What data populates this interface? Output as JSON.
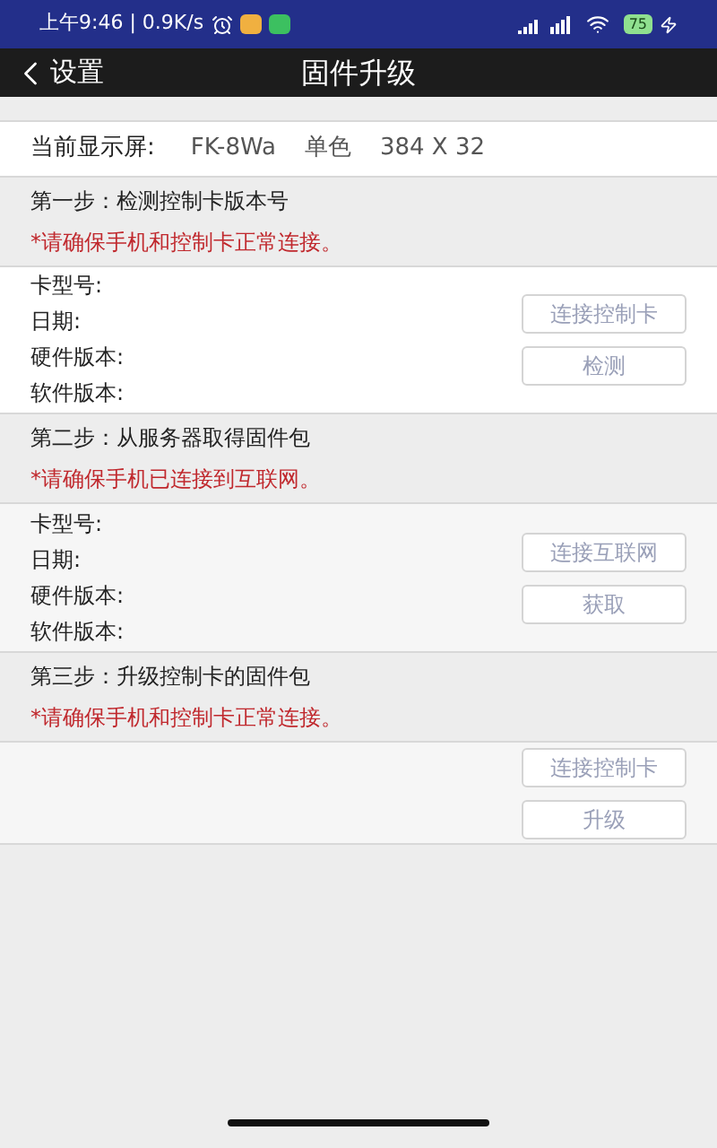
{
  "status_bar": {
    "time": "上午9:46 | 0.9K/s",
    "battery": "75"
  },
  "nav": {
    "back": "设置",
    "title": "固件升级"
  },
  "display": {
    "label": "当前显示屏:",
    "model": "FK-8Wa",
    "color_mode": "单色",
    "resolution": "384 X 32"
  },
  "steps": [
    {
      "title": "第一步：检测控制卡版本号",
      "warning": "*请确保手机和控制卡正常连接。",
      "fields": [
        "卡型号:",
        "日期:",
        "硬件版本:",
        "软件版本:"
      ],
      "buttons": [
        {
          "label": "连接控制卡",
          "disabled": true
        },
        {
          "label": "检测",
          "disabled": true
        }
      ]
    },
    {
      "title": "第二步：从服务器取得固件包",
      "warning": "*请确保手机已连接到互联网。",
      "fields": [
        "卡型号:",
        "日期:",
        "硬件版本:",
        "软件版本:"
      ],
      "buttons": [
        {
          "label": "连接互联网",
          "disabled": true
        },
        {
          "label": "获取",
          "disabled": true
        }
      ]
    },
    {
      "title": "第三步：升级控制卡的固件包",
      "warning": "*请确保手机和控制卡正常连接。",
      "buttons": [
        {
          "label": "连接控制卡",
          "disabled": true
        },
        {
          "label": "升级",
          "disabled": true
        }
      ]
    }
  ]
}
